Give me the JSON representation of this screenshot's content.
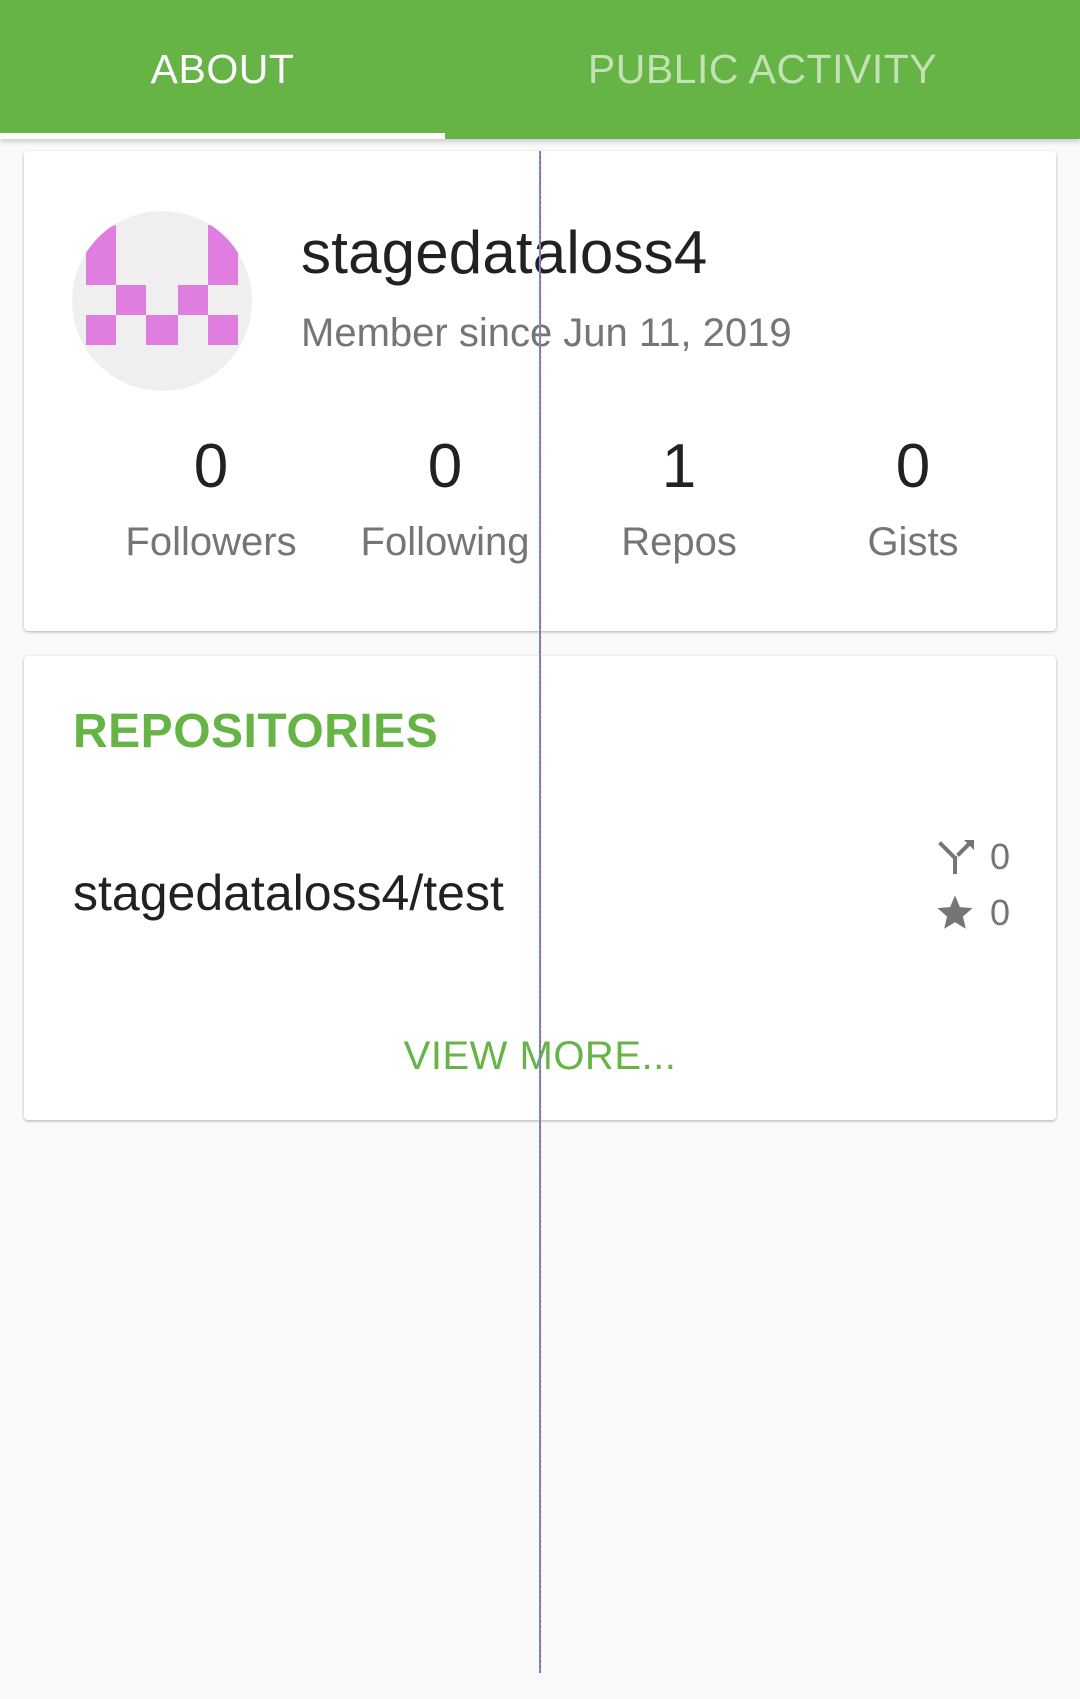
{
  "tabs": [
    {
      "label": "ABOUT",
      "selected": true
    },
    {
      "label": "PUBLIC ACTIVITY",
      "selected": false
    }
  ],
  "profile": {
    "username": "stagedataloss4",
    "member_since": "Member since Jun 11, 2019",
    "avatar_color": "#e07ee0",
    "stats": [
      {
        "value": "0",
        "label": "Followers"
      },
      {
        "value": "0",
        "label": "Following"
      },
      {
        "value": "1",
        "label": "Repos"
      },
      {
        "value": "0",
        "label": "Gists"
      }
    ]
  },
  "repositories": {
    "heading": "REPOSITORIES",
    "items": [
      {
        "name": "stagedataloss4/test",
        "forks": "0",
        "stars": "0"
      }
    ],
    "view_more": "VIEW MORE..."
  },
  "colors": {
    "accent": "#66b446",
    "icon_gray": "#757575"
  }
}
